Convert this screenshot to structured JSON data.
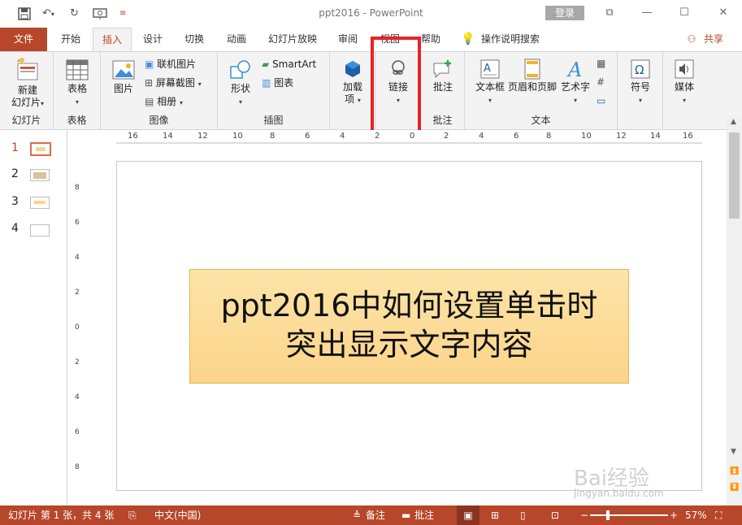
{
  "titlebar": {
    "title": "ppt2016 - PowerPoint",
    "login": "登录",
    "save_icon": "save-icon",
    "undo_icon": "undo-icon",
    "redo_icon": "redo-icon",
    "present_icon": "present-icon"
  },
  "tabs": [
    {
      "label": "文件"
    },
    {
      "label": "开始"
    },
    {
      "label": "插入"
    },
    {
      "label": "设计"
    },
    {
      "label": "切换"
    },
    {
      "label": "动画"
    },
    {
      "label": "幻灯片放映"
    },
    {
      "label": "审阅"
    },
    {
      "label": "视图"
    },
    {
      "label": "帮助"
    },
    {
      "label": "操作说明搜索"
    },
    {
      "label": "共享"
    }
  ],
  "ribbon": {
    "new_slide": "新建\n幻灯片",
    "new_slide_l1": "新建",
    "new_slide_l2": "幻灯片",
    "group_slides": "幻灯片",
    "table": "表格",
    "group_table": "表格",
    "picture": "图片",
    "online_picture": "联机图片",
    "screenshot": "屏幕截图",
    "album": "相册",
    "group_images": "图像",
    "shapes": "形状",
    "smartart": "SmartArt",
    "chart": "图表",
    "group_illustrations": "插图",
    "addins_l1": "加载",
    "addins_l2": "项",
    "link": "链接",
    "comment": "批注",
    "group_comments": "批注",
    "textbox": "文本框",
    "header_footer": "页眉和页脚",
    "wordart": "艺术字",
    "group_text": "文本",
    "symbol": "符号",
    "media": "媒体"
  },
  "thumbnails": [
    "1",
    "2",
    "3",
    "4"
  ],
  "hruler": [
    "16",
    "14",
    "12",
    "10",
    "8",
    "6",
    "4",
    "2",
    "0",
    "2",
    "4",
    "6",
    "8",
    "10",
    "12",
    "14",
    "16"
  ],
  "vruler": [
    "8",
    "6",
    "4",
    "2",
    "0",
    "2",
    "4",
    "6",
    "8"
  ],
  "slide": {
    "line1": "ppt2016中如何设置单击时",
    "line2": "突出显示文字内容"
  },
  "status": {
    "slide_info": "幻灯片 第 1 张，共 4 张",
    "language": "中文(中国)",
    "notes": "备注",
    "comments": "批注",
    "zoom": "57%"
  },
  "watermark": {
    "brand": "Bai经验",
    "url": "jingyan.baidu.com"
  },
  "colors": {
    "accent": "#b7472a",
    "highlight": "#e8232a",
    "textbox_fill": "#fcd992"
  }
}
